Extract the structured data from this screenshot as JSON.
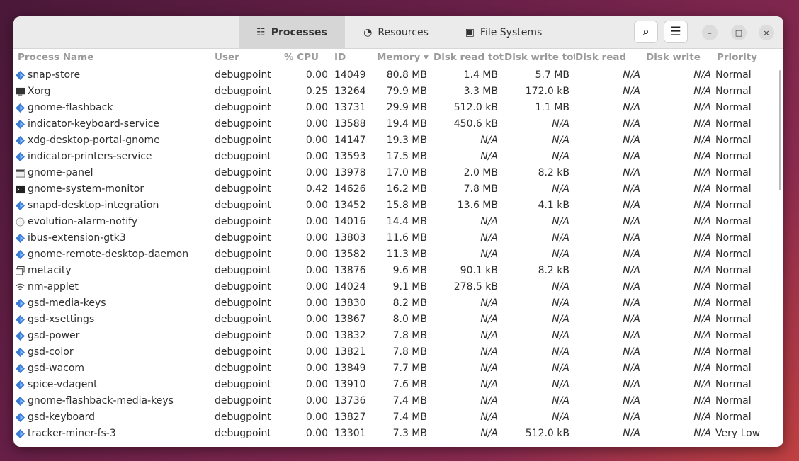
{
  "tabs": [
    {
      "label": "Processes",
      "icon": "list-icon",
      "active": true
    },
    {
      "label": "Resources",
      "icon": "gauge-icon"
    },
    {
      "label": "File Systems",
      "icon": "disk-icon"
    }
  ],
  "columns": [
    "Process Name",
    "User",
    "% CPU",
    "ID",
    "Memory ▾",
    "Disk read tota",
    "Disk write tot",
    "Disk read",
    "Disk write",
    "Priority"
  ],
  "rows": [
    [
      "snap-store",
      "debugpoint",
      "0.00",
      "14049",
      "80.8 MB",
      "1.4 MB",
      "5.7 MB",
      "N/A",
      "N/A",
      "Normal",
      "diamond"
    ],
    [
      "Xorg",
      "debugpoint",
      "0.25",
      "13264",
      "79.9 MB",
      "3.3 MB",
      "172.0 kB",
      "N/A",
      "N/A",
      "Normal",
      "monitor"
    ],
    [
      "gnome-flashback",
      "debugpoint",
      "0.00",
      "13731",
      "29.9 MB",
      "512.0 kB",
      "1.1 MB",
      "N/A",
      "N/A",
      "Normal",
      "diamond"
    ],
    [
      "indicator-keyboard-service",
      "debugpoint",
      "0.00",
      "13588",
      "19.4 MB",
      "450.6 kB",
      "N/A",
      "N/A",
      "N/A",
      "Normal",
      "diamond"
    ],
    [
      "xdg-desktop-portal-gnome",
      "debugpoint",
      "0.00",
      "14147",
      "19.3 MB",
      "N/A",
      "N/A",
      "N/A",
      "N/A",
      "Normal",
      "diamond"
    ],
    [
      "indicator-printers-service",
      "debugpoint",
      "0.00",
      "13593",
      "17.5 MB",
      "N/A",
      "N/A",
      "N/A",
      "N/A",
      "Normal",
      "diamond"
    ],
    [
      "gnome-panel",
      "debugpoint",
      "0.00",
      "13978",
      "17.0 MB",
      "2.0 MB",
      "8.2 kB",
      "N/A",
      "N/A",
      "Normal",
      "panel"
    ],
    [
      "gnome-system-monitor",
      "debugpoint",
      "0.42",
      "14626",
      "16.2 MB",
      "7.8 MB",
      "N/A",
      "N/A",
      "N/A",
      "Normal",
      "terminal"
    ],
    [
      "snapd-desktop-integration",
      "debugpoint",
      "0.00",
      "13452",
      "15.8 MB",
      "13.6 MB",
      "4.1 kB",
      "N/A",
      "N/A",
      "Normal",
      "diamond"
    ],
    [
      "evolution-alarm-notify",
      "debugpoint",
      "0.00",
      "14016",
      "14.4 MB",
      "N/A",
      "N/A",
      "N/A",
      "N/A",
      "Normal",
      "bell"
    ],
    [
      "ibus-extension-gtk3",
      "debugpoint",
      "0.00",
      "13803",
      "11.6 MB",
      "N/A",
      "N/A",
      "N/A",
      "N/A",
      "Normal",
      "diamond"
    ],
    [
      "gnome-remote-desktop-daemon",
      "debugpoint",
      "0.00",
      "13582",
      "11.3 MB",
      "N/A",
      "N/A",
      "N/A",
      "N/A",
      "Normal",
      "diamond"
    ],
    [
      "metacity",
      "debugpoint",
      "0.00",
      "13876",
      "9.6 MB",
      "90.1 kB",
      "8.2 kB",
      "N/A",
      "N/A",
      "Normal",
      "windows"
    ],
    [
      "nm-applet",
      "debugpoint",
      "0.00",
      "14024",
      "9.1 MB",
      "278.5 kB",
      "N/A",
      "N/A",
      "N/A",
      "Normal",
      "wifi"
    ],
    [
      "gsd-media-keys",
      "debugpoint",
      "0.00",
      "13830",
      "8.2 MB",
      "N/A",
      "N/A",
      "N/A",
      "N/A",
      "Normal",
      "diamond"
    ],
    [
      "gsd-xsettings",
      "debugpoint",
      "0.00",
      "13867",
      "8.0 MB",
      "N/A",
      "N/A",
      "N/A",
      "N/A",
      "Normal",
      "diamond"
    ],
    [
      "gsd-power",
      "debugpoint",
      "0.00",
      "13832",
      "7.8 MB",
      "N/A",
      "N/A",
      "N/A",
      "N/A",
      "Normal",
      "diamond"
    ],
    [
      "gsd-color",
      "debugpoint",
      "0.00",
      "13821",
      "7.8 MB",
      "N/A",
      "N/A",
      "N/A",
      "N/A",
      "Normal",
      "diamond"
    ],
    [
      "gsd-wacom",
      "debugpoint",
      "0.00",
      "13849",
      "7.7 MB",
      "N/A",
      "N/A",
      "N/A",
      "N/A",
      "Normal",
      "diamond"
    ],
    [
      "spice-vdagent",
      "debugpoint",
      "0.00",
      "13910",
      "7.6 MB",
      "N/A",
      "N/A",
      "N/A",
      "N/A",
      "Normal",
      "diamond"
    ],
    [
      "gnome-flashback-media-keys",
      "debugpoint",
      "0.00",
      "13736",
      "7.4 MB",
      "N/A",
      "N/A",
      "N/A",
      "N/A",
      "Normal",
      "diamond"
    ],
    [
      "gsd-keyboard",
      "debugpoint",
      "0.00",
      "13827",
      "7.4 MB",
      "N/A",
      "N/A",
      "N/A",
      "N/A",
      "Normal",
      "diamond"
    ],
    [
      "tracker-miner-fs-3",
      "debugpoint",
      "0.00",
      "13301",
      "7.3 MB",
      "N/A",
      "512.0 kB",
      "N/A",
      "N/A",
      "Very Low",
      "diamond"
    ]
  ],
  "colors": {
    "accent": "#3a7bd5",
    "header_bg": "#ebebeb",
    "active_tab": "#d6d6d6"
  }
}
